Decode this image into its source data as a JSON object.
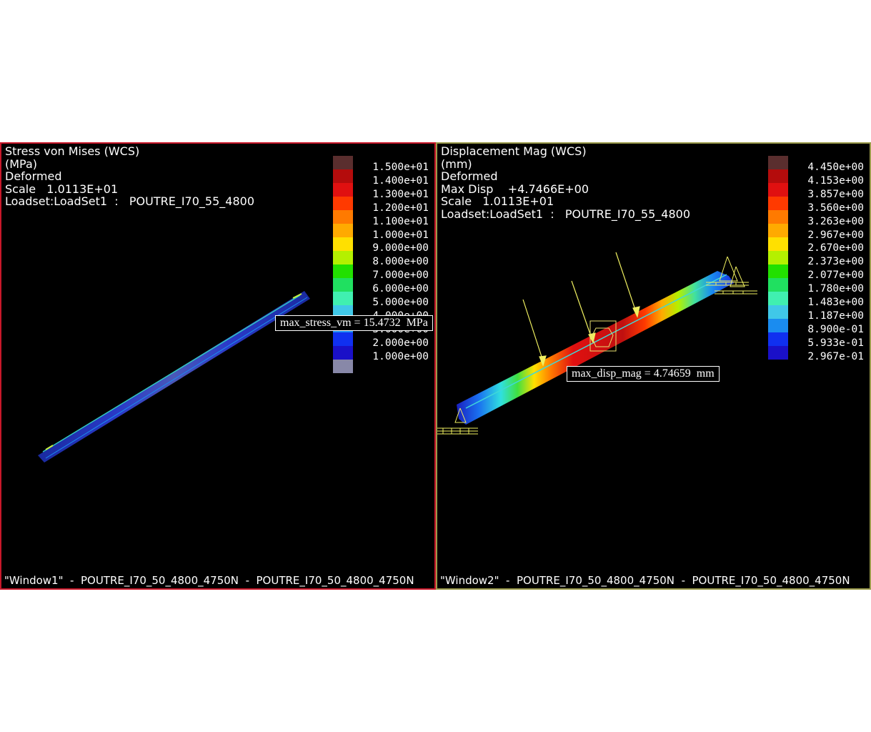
{
  "window1": {
    "title": "Stress von Mises (WCS)",
    "units": "(MPa)",
    "mode": "Deformed",
    "scale": "Scale   1.0113E+01",
    "loadset": "Loadset:LoadSet1  :   POUTRE_I70_55_4800",
    "legend_labels": [
      "1.500e+01",
      "1.400e+01",
      "1.300e+01",
      "1.200e+01",
      "1.100e+01",
      "1.000e+01",
      "9.000e+00",
      "8.000e+00",
      "7.000e+00",
      "6.000e+00",
      "5.000e+00",
      "4.000e+00",
      "3.000e+00",
      "2.000e+00",
      "1.000e+00"
    ],
    "legend_colors": [
      "#5a2e2e",
      "#b40c0c",
      "#e01010",
      "#ff3a00",
      "#ff7a00",
      "#ffaa00",
      "#ffe000",
      "#b4f000",
      "#22e000",
      "#20e060",
      "#40f0b0",
      "#40c8e8",
      "#1a8cf0",
      "#1030f0",
      "#1a10c8",
      "#8888a8"
    ],
    "callout": "max_stress_vm = 15.4732  MPa",
    "footer": "\"Window1\"  -  POUTRE_I70_50_4800_4750N  -  POUTRE_I70_50_4800_4750N"
  },
  "window2": {
    "title": "Displacement Mag (WCS)",
    "units": "(mm)",
    "mode": "Deformed",
    "max_disp": "Max Disp    +4.7466E+00",
    "scale": "Scale   1.0113E+01",
    "loadset": "Loadset:LoadSet1  :   POUTRE_I70_55_4800",
    "legend_labels": [
      "4.450e+00",
      "4.153e+00",
      "3.857e+00",
      "3.560e+00",
      "3.263e+00",
      "2.967e+00",
      "2.670e+00",
      "2.373e+00",
      "2.077e+00",
      "1.780e+00",
      "1.483e+00",
      "1.187e+00",
      "8.900e-01",
      "5.933e-01",
      "2.967e-01"
    ],
    "legend_colors": [
      "#5a2e2e",
      "#b40c0c",
      "#e01010",
      "#ff3a00",
      "#ff7a00",
      "#ffaa00",
      "#ffe000",
      "#b4f000",
      "#22e000",
      "#20e060",
      "#40f0b0",
      "#40c8e8",
      "#1a8cf0",
      "#1030f0",
      "#1a10c8"
    ],
    "callout": "max_disp_mag = 4.74659  mm",
    "footer": "\"Window2\"  -  POUTRE_I70_50_4800_4750N  -  POUTRE_I70_50_4800_4750N"
  }
}
